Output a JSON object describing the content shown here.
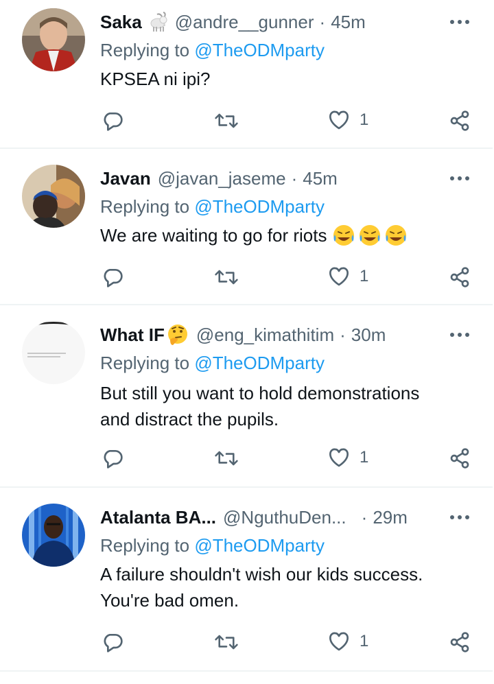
{
  "tweets": [
    {
      "name": "Saka",
      "name_emoji": "goat-emoji",
      "handle": "@andre__gunner",
      "time": "45m",
      "reply_prefix": "Replying to",
      "reply_to": "@TheODMparty",
      "text": "KPSEA ni ipi?",
      "like_count": "1"
    },
    {
      "name": "Javan",
      "handle": "@javan_jaseme",
      "time": "45m",
      "reply_prefix": "Replying to",
      "reply_to": "@TheODMparty",
      "text": "We are waiting to go for riots",
      "text_emoji": "😂😂😂",
      "like_count": "1"
    },
    {
      "name": "What IF",
      "name_emoji": "🤔",
      "handle": "@eng_kimathitim",
      "time": "30m",
      "reply_prefix": "Replying to",
      "reply_to": "@TheODMparty",
      "text_line1": "But still you want to hold demonstrations",
      "text_line2": "and distract the pupils.",
      "like_count": "1"
    },
    {
      "name": "Atalanta BA...",
      "handle": "@NguthuDen...",
      "time": "29m",
      "reply_prefix": "Replying to",
      "reply_to": "@TheODMparty",
      "text_line1": "A failure shouldn't wish our kids success.",
      "text_line2": "You're bad omen.",
      "like_count": "1"
    }
  ],
  "colors": {
    "accent": "#1d9bf0",
    "secondary_text": "#536471",
    "primary_text": "#0f1419",
    "divider": "#eff3f4"
  },
  "icons": [
    "more-icon",
    "reply-icon",
    "retweet-icon",
    "like-icon",
    "share-icon"
  ]
}
